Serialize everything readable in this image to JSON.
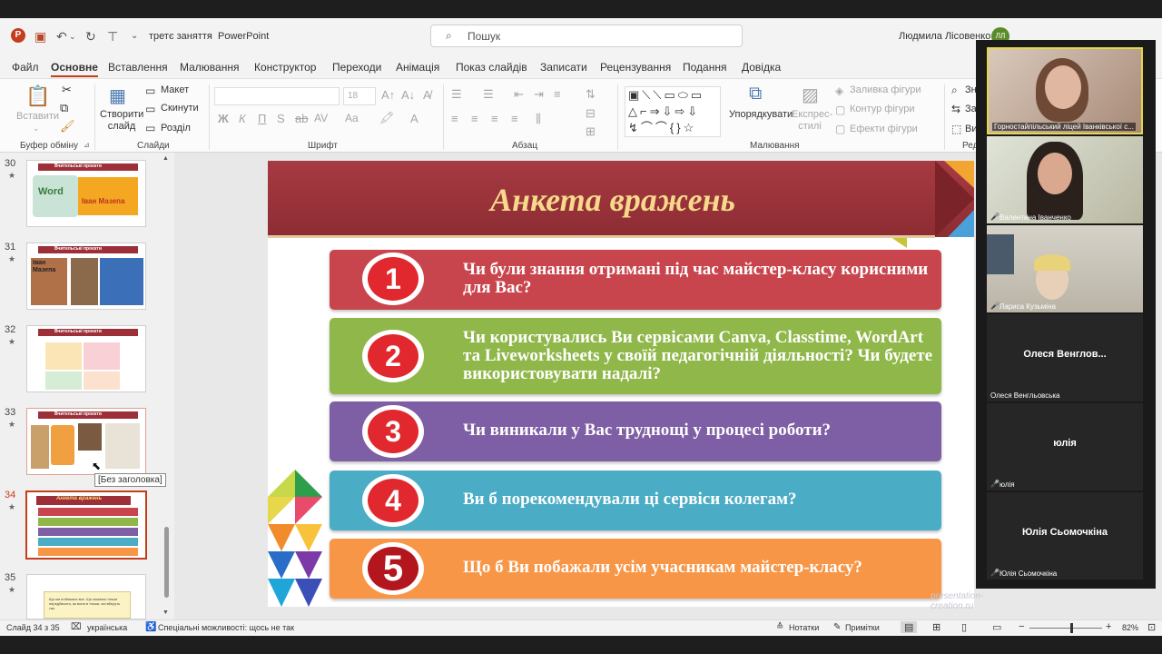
{
  "app": {
    "file_title": "третє заняття",
    "separator": "-",
    "app_name": "PowerPoint",
    "search_placeholder": "Пошук",
    "user_name": "Людмила Лісовенко",
    "user_initials": "ЛЛ"
  },
  "menu": [
    "Файл",
    "Основне",
    "Вставлення",
    "Малювання",
    "Конструктор",
    "Переходи",
    "Анімація",
    "Показ слайдів",
    "Записати",
    "Рецензування",
    "Подання",
    "Довідка"
  ],
  "ribbon": {
    "paste": "Вставити",
    "clipboard_group": "Буфер обміну",
    "new_slide": "Створити слайд",
    "layout": "Макет",
    "reset": "Скинути",
    "section": "Розділ",
    "slides_group": "Слайди",
    "font_size": "18",
    "font_group": "Шрифт",
    "paragraph_group": "Абзац",
    "arrange": "Упорядкувати",
    "quick_styles": "Експрес-стилі",
    "shape_fill": "Заливка фігури",
    "shape_outline": "Контур фігури",
    "shape_effects": "Ефекти фігури",
    "drawing_group": "Малювання",
    "find_cut": "Зн",
    "replace_cut": "За",
    "select_cut": "Ви",
    "editing_cut": "Ред"
  },
  "thumbs": [
    {
      "num": "30",
      "title": "Вчительські проєкти",
      "star": "★"
    },
    {
      "num": "31",
      "title": "Вчительські проєкти",
      "star": "★"
    },
    {
      "num": "32",
      "title": "Вчительські проєкти",
      "star": "★"
    },
    {
      "num": "33",
      "title": "Вчительські проєкти",
      "star": "★"
    },
    {
      "num": "34",
      "title": "Анкета вражень",
      "star": "★"
    },
    {
      "num": "35",
      "title": "",
      "star": "★"
    }
  ],
  "thumb_texts": {
    "t30_word": "Word",
    "t30_label": "Іван Мазепа",
    "t31_name": "Іван Мазепа",
    "t35_text": "Що ми побажали все. Що можемо тільки передбачити, як вони в тільки, всі вберуть так."
  },
  "tooltip": "[Без заголовка]",
  "slide": {
    "title": "Анкета вражень",
    "watermark": "presentation-creation.ru",
    "questions": [
      {
        "num": "1",
        "text": "Чи були знання отримані під час майстер-класу корисними для Вас?",
        "color": "#c9454d"
      },
      {
        "num": "2",
        "text": "Чи користувались Ви сервісами Canva, Classtime, WordArt та Liveworksheets у своїй педагогічній діяльності? Чи будете використовувати надалі?",
        "color": "#8fb749"
      },
      {
        "num": "3",
        "text": "Чи виникали у Вас труднощі у процесі роботи?",
        "color": "#7e5ea4"
      },
      {
        "num": "4",
        "text": "Ви б порекомендували ці сервіси колегам?",
        "color": "#4bacc6"
      },
      {
        "num": "5",
        "text": "Що б Ви побажали усім учасникам майстер-класу?",
        "color": "#f79646"
      }
    ]
  },
  "participants": [
    {
      "name": "Горностайпільський ліцей Іванківської с...",
      "big": "",
      "video": true
    },
    {
      "name": "Валентина Іванченко",
      "big": "",
      "video": true
    },
    {
      "name": "Лариса Кузьміна",
      "big": "",
      "video": true
    },
    {
      "name": "Олеся Венгльовська",
      "big": "Олеся Венглов...",
      "video": false
    },
    {
      "name": "юлія",
      "big": "юлія",
      "video": false
    },
    {
      "name": "Юлія Сьомочкіна",
      "big": "Юлія Сьомочкіна",
      "video": false
    }
  ],
  "status": {
    "slide_counter": "Слайд 34 з 35",
    "language": "українська",
    "accessibility": "Спеціальні можливості: щось не так",
    "notes": "Нотатки",
    "comments": "Примітки",
    "zoom": "82%",
    "zoom_level": 0.57
  }
}
